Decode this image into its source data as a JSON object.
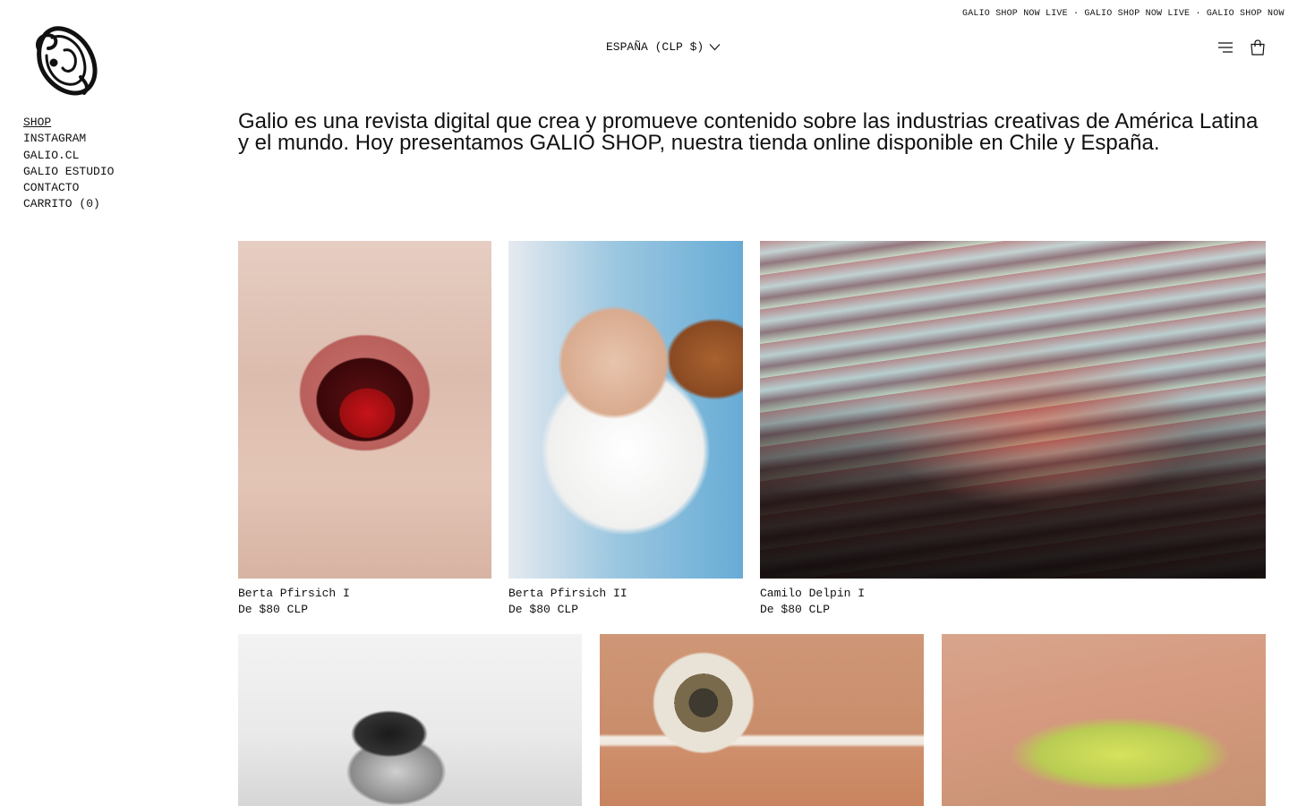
{
  "announcement": {
    "text": "GALIO SHOP NOW LIVE · GALIO SHOP NOW LIVE · GALIO SHOP NOW LIVE"
  },
  "header": {
    "locale_label": "ESPAÑA (CLP $)",
    "icons": [
      "menu-icon",
      "bag-icon"
    ]
  },
  "sidebar": {
    "items": [
      {
        "label": "SHOP",
        "active": true
      },
      {
        "label": "INSTAGRAM"
      },
      {
        "label": "GALIO.CL"
      },
      {
        "label": "GALIO ESTUDIO"
      },
      {
        "label": "CONTACTO"
      },
      {
        "label": "CARRITO (0)"
      }
    ]
  },
  "intro": {
    "text": "Galio es una revista digital que crea y promueve contenido sobre las industrias creativas de América Latina y el mundo. Hoy presentamos GALIO SHOP, nuestra tienda online disponible en Chile y España."
  },
  "products": [
    {
      "title": "Berta Pfirsich I",
      "price": "De $80 CLP"
    },
    {
      "title": "Berta Pfirsich II",
      "price": "De $80 CLP"
    },
    {
      "title": "Camilo Delpin I",
      "price": "De $80 CLP"
    },
    {
      "title": "",
      "price": ""
    },
    {
      "title": "",
      "price": ""
    },
    {
      "title": "",
      "price": ""
    }
  ]
}
